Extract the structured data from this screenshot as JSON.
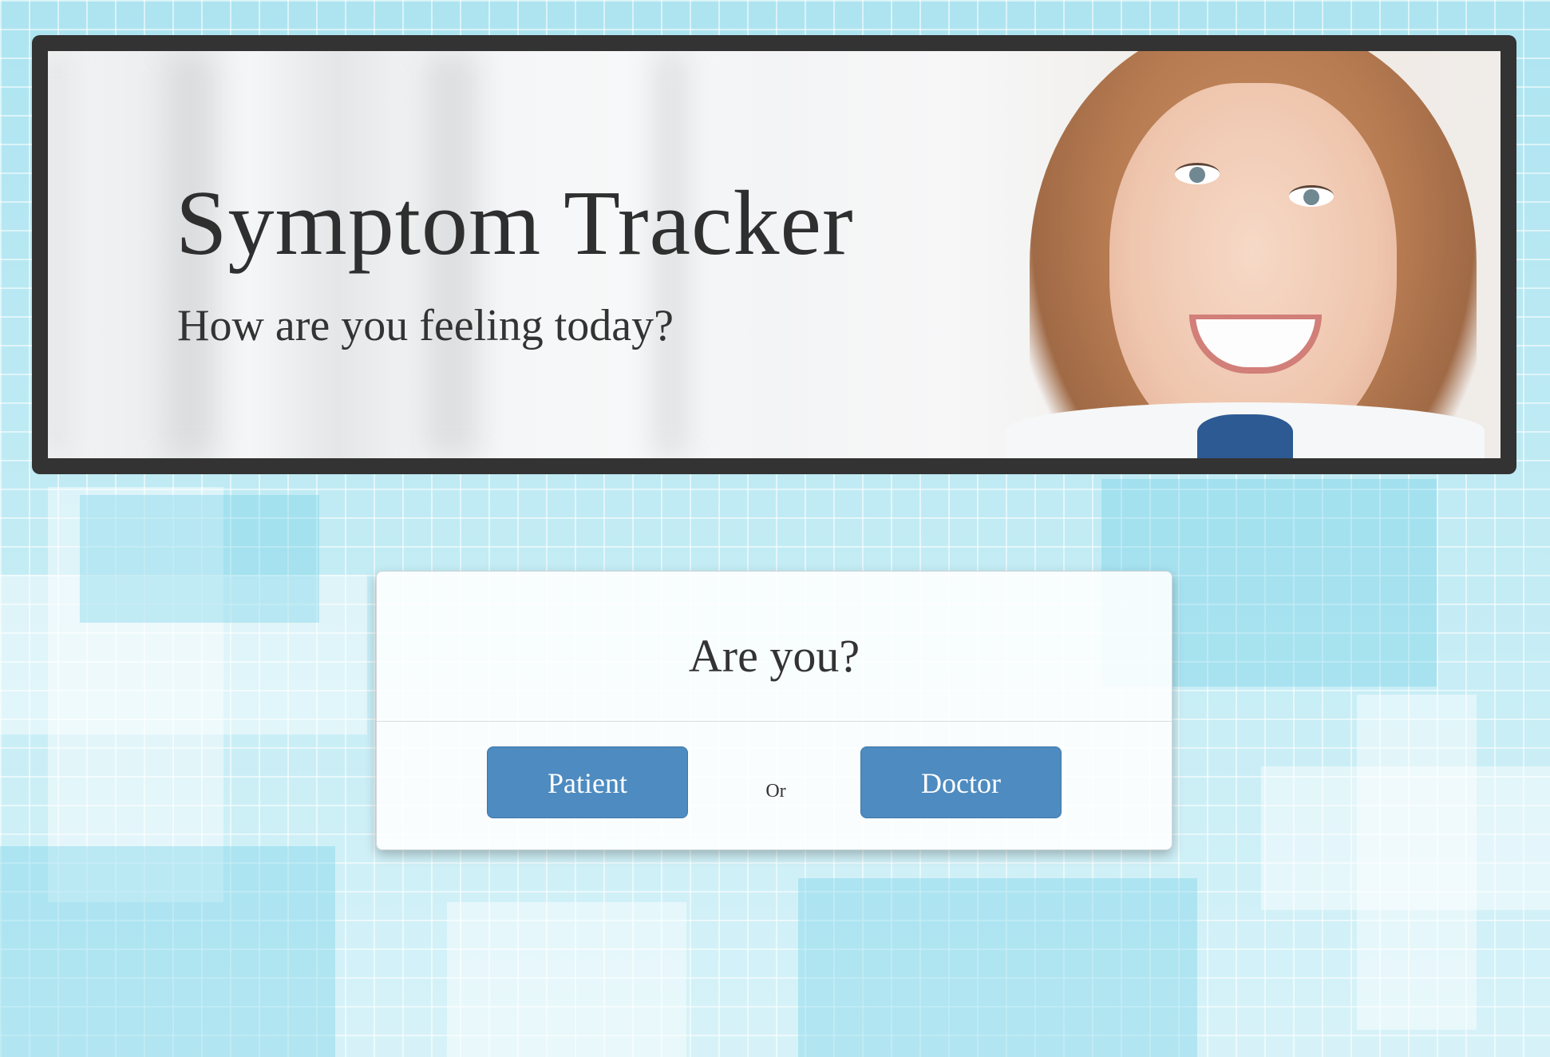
{
  "header": {
    "title": "Symptom Tracker",
    "subtitle": "How are you feeling today?"
  },
  "role_card": {
    "title": "Are you?",
    "patient_label": "Patient",
    "separator": "Or",
    "doctor_label": "Doctor"
  },
  "colors": {
    "button": "#4e8bc0",
    "banner_border": "#333333",
    "background": "#c9eef6"
  }
}
